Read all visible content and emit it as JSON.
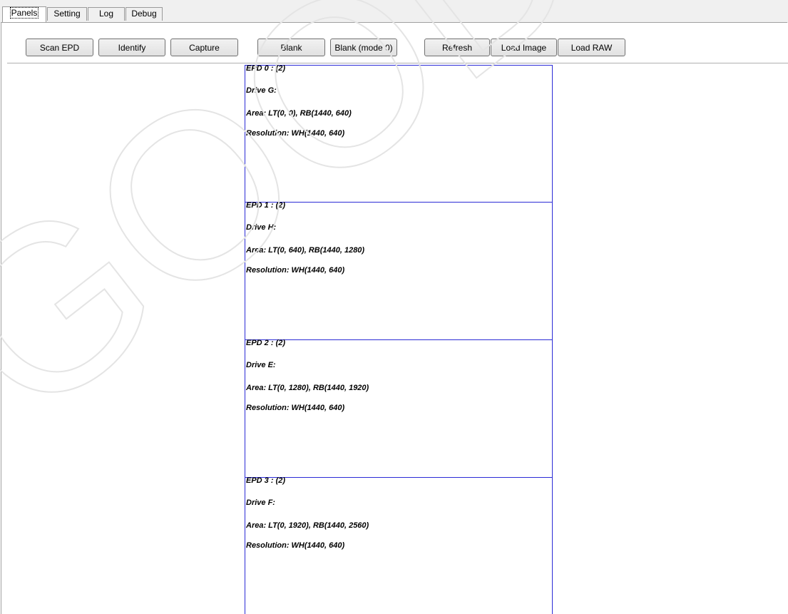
{
  "tabs": [
    {
      "label": "Panels"
    },
    {
      "label": "Setting"
    },
    {
      "label": "Log"
    },
    {
      "label": "Debug"
    }
  ],
  "toolbar": {
    "scan_epd": "Scan EPD",
    "identify": "Identify",
    "capture": "Capture",
    "blank": "Blank",
    "blank_mode0": "Blank (mode 0)",
    "refresh": "Refresh",
    "load_image": "Load Image",
    "load_raw": "Load RAW"
  },
  "epds": [
    {
      "title": "EPD 0 : (2)",
      "drive": "Drive G:",
      "area": "Area:  LT(0, 0), RB(1440, 640)",
      "resolution": "Resolution:  WH(1440, 640)"
    },
    {
      "title": "EPD 1 : (2)",
      "drive": "Drive H:",
      "area": "Area:  LT(0, 640), RB(1440, 1280)",
      "resolution": "Resolution:  WH(1440, 640)"
    },
    {
      "title": "EPD 2 : (2)",
      "drive": "Drive E:",
      "area": "Area:  LT(0, 1280), RB(1440, 1920)",
      "resolution": "Resolution:  WH(1440, 640)"
    },
    {
      "title": "EPD 3 : (2)",
      "drive": "Drive F:",
      "area": "Area:  LT(0, 1920), RB(1440, 2560)",
      "resolution": "Resolution:  WH(1440, 640)"
    }
  ],
  "colors": {
    "panel_border": "#2b2bd6",
    "watermark": "#e6e6e6"
  },
  "watermark": {
    "text": "GOOD D"
  }
}
